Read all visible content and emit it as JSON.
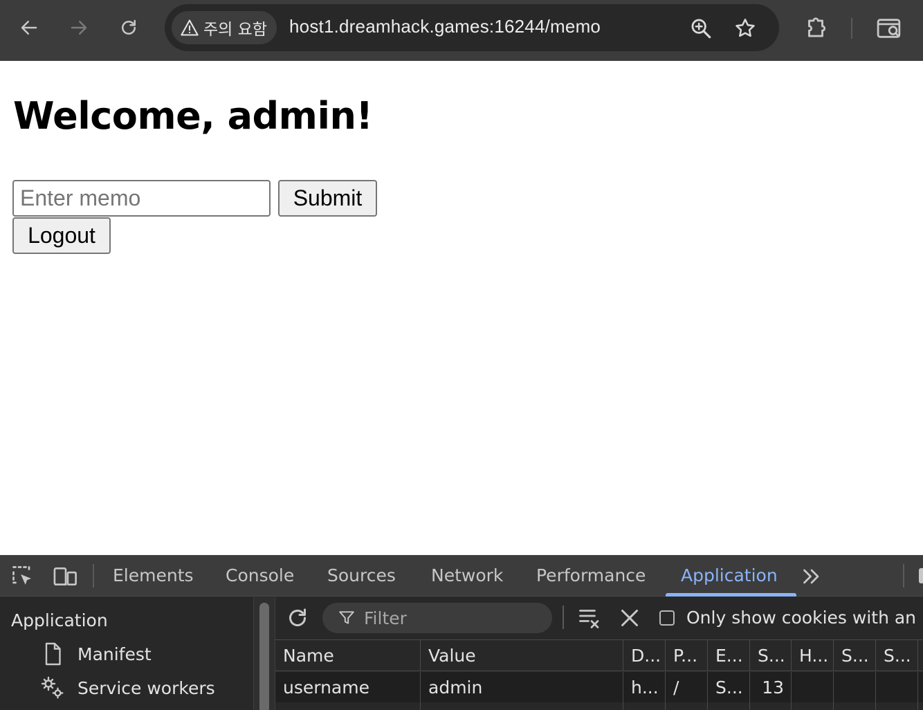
{
  "browser": {
    "security_label": "주의 요함",
    "url": "host1.dreamhack.games:16244/memo",
    "icons": [
      "back-icon",
      "forward-icon",
      "reload-icon",
      "warning-icon",
      "zoom-icon",
      "star-icon",
      "extensions-icon",
      "search-tabs-icon"
    ]
  },
  "page": {
    "title": "Welcome, admin!",
    "memo_placeholder": "Enter memo",
    "memo_value": "",
    "submit_label": "Submit",
    "logout_label": "Logout"
  },
  "devtools": {
    "tabs": [
      "Elements",
      "Console",
      "Sources",
      "Network",
      "Performance",
      "Application"
    ],
    "active_tab": "Application",
    "sidebar": {
      "heading": "Application",
      "items": [
        "Manifest",
        "Service workers"
      ]
    },
    "toolbar": {
      "filter_placeholder": "Filter",
      "only_show_label": "Only show cookies with an i",
      "only_show_checked": false
    },
    "cookies": {
      "columns": [
        "Name",
        "Value",
        "D...",
        "P...",
        "E...",
        "S...",
        "H...",
        "S...",
        "S..."
      ],
      "rows": [
        [
          "username",
          "admin",
          "h...",
          "/",
          "S...",
          "13",
          "",
          "",
          ""
        ]
      ]
    },
    "accent_color": "#8ab4f8"
  }
}
